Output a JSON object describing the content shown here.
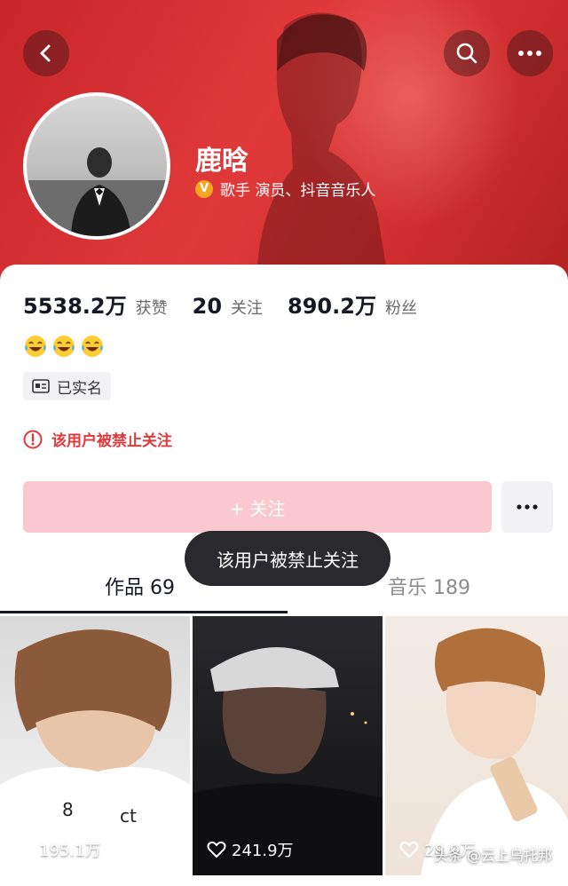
{
  "profile": {
    "name": "鹿晗",
    "verified_title": "歌手 演员、抖音音乐人",
    "verified_badge": "V",
    "stats": [
      {
        "value": "5538.2万",
        "label": "获赞"
      },
      {
        "value": "20",
        "label": "关注"
      },
      {
        "value": "890.2万",
        "label": "粉丝"
      }
    ],
    "realname_label": "已实名",
    "banned_notice": "该用户被禁止关注"
  },
  "actions": {
    "follow_label": "+ 关注"
  },
  "toast": "该用户被禁止关注",
  "tabs": [
    {
      "label": "作品 69"
    },
    {
      "label": "音乐 189"
    }
  ],
  "videos": [
    {
      "likes": "195.1万"
    },
    {
      "likes": "241.9万"
    },
    {
      "likes": "28.9万"
    }
  ],
  "watermark": "头条 @云上乌托邦",
  "colors": {
    "accent": "#e0393a",
    "follow_disabled": "#f9c9cf",
    "header": "#d12f31"
  },
  "icons": [
    "back-icon",
    "search-icon",
    "more-icon",
    "warning-icon",
    "id-card-icon",
    "heart-icon"
  ]
}
